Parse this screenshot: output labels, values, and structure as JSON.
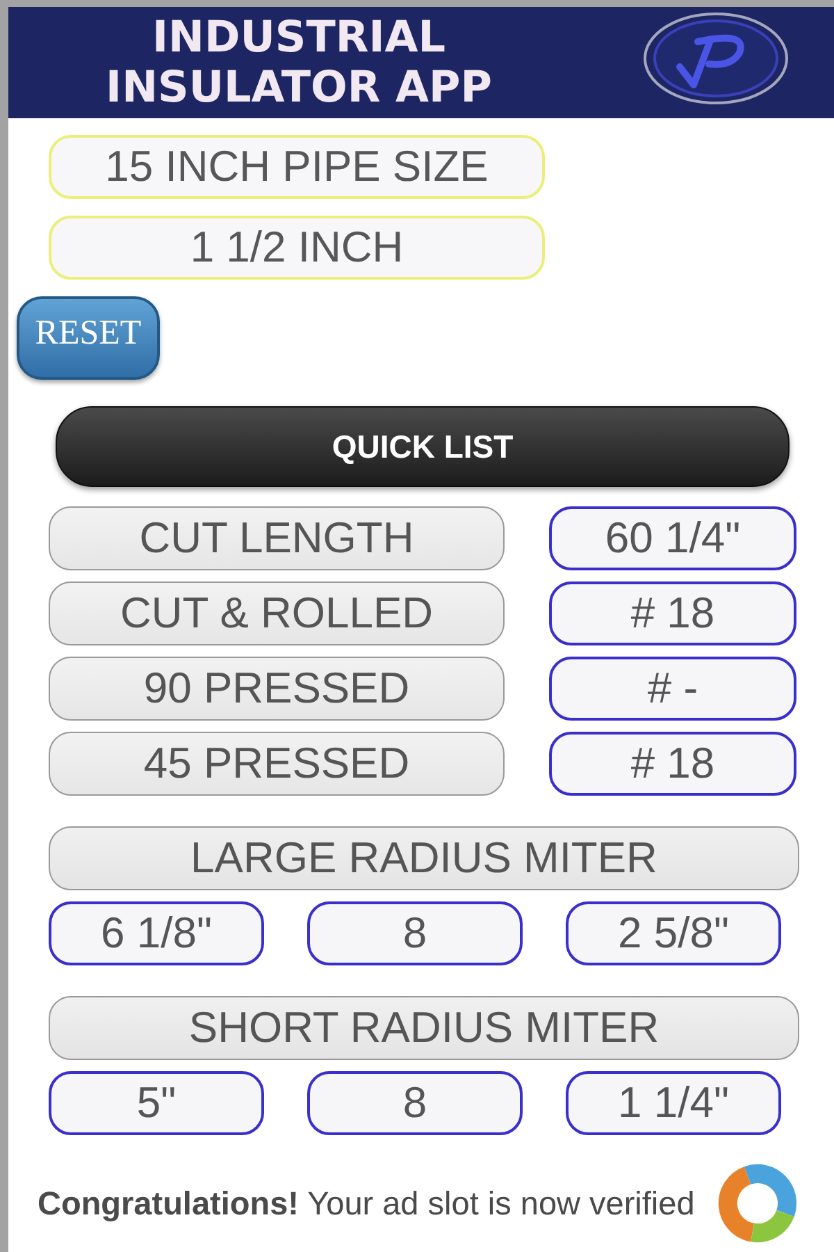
{
  "header": {
    "title": "INDUSTRIAL INSULATOR APP"
  },
  "selectors": [
    {
      "value": "15 INCH PIPE SIZE"
    },
    {
      "value": "1 1/2 INCH"
    }
  ],
  "reset_button": {
    "label": "RESET"
  },
  "quick_list": {
    "title": "QUICK LIST",
    "rows": [
      {
        "label": "CUT LENGTH",
        "value": "60 1/4\""
      },
      {
        "label": "CUT & ROLLED",
        "value": "# 18"
      },
      {
        "label": "90 PRESSED",
        "value": "# -"
      },
      {
        "label": "45 PRESSED",
        "value": "# 18"
      }
    ]
  },
  "miters": [
    {
      "title": "LARGE RADIUS MITER",
      "values": [
        "6 1/8\"",
        "8",
        "2 5/8\""
      ]
    },
    {
      "title": "SHORT RADIUS MITER",
      "values": [
        "5\"",
        "8",
        "1 1/4\""
      ]
    }
  ],
  "ad_banner": {
    "text": "**Congratulations!** Your ad slot is now verified"
  }
}
